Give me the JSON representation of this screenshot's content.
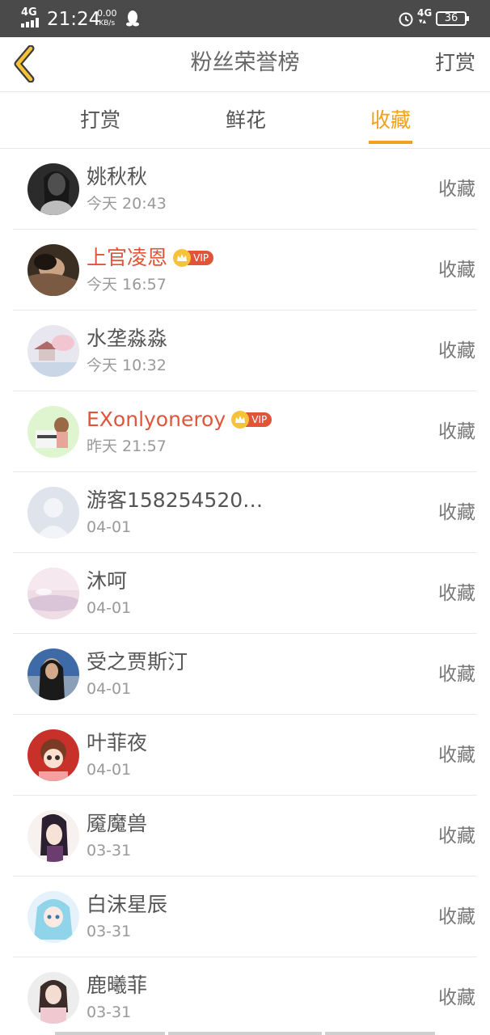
{
  "status_bar": {
    "network": "4G",
    "time": "21:24",
    "speed_value": "0.00",
    "speed_unit": "KB/s",
    "network2": "4G",
    "battery": "36"
  },
  "header": {
    "title": "粉丝荣誉榜",
    "right_action": "打赏",
    "back_icon": "chevron-left-icon"
  },
  "tabs": [
    {
      "label": "打赏",
      "active": false
    },
    {
      "label": "鲜花",
      "active": false
    },
    {
      "label": "收藏",
      "active": true
    }
  ],
  "colors": {
    "accent": "#f0a01c",
    "vip_name": "#e0553a",
    "status_bar": "#4a4a4a"
  },
  "list": [
    {
      "name": "姚秋秋",
      "time": "今天 20:43",
      "action": "收藏",
      "vip": false
    },
    {
      "name": "上官凌恩",
      "time": "今天 16:57",
      "action": "收藏",
      "vip": true,
      "badge": "VIP"
    },
    {
      "name": "水垄淼淼",
      "time": "今天 10:32",
      "action": "收藏",
      "vip": false
    },
    {
      "name": "EXonlyoneroy",
      "time": "昨天 21:57",
      "action": "收藏",
      "vip": true,
      "badge": "VIP"
    },
    {
      "name": "游客158254520…",
      "time": "04-01",
      "action": "收藏",
      "vip": false
    },
    {
      "name": "沐呵",
      "time": "04-01",
      "action": "收藏",
      "vip": false
    },
    {
      "name": "受之贾斯汀",
      "time": "04-01",
      "action": "收藏",
      "vip": false
    },
    {
      "name": "叶菲夜",
      "time": "04-01",
      "action": "收藏",
      "vip": false
    },
    {
      "name": "魇魔兽",
      "time": "03-31",
      "action": "收藏",
      "vip": false
    },
    {
      "name": "白沫星辰",
      "time": "03-31",
      "action": "收藏",
      "vip": false
    },
    {
      "name": "鹿曦菲",
      "time": "03-31",
      "action": "收藏",
      "vip": false
    }
  ]
}
